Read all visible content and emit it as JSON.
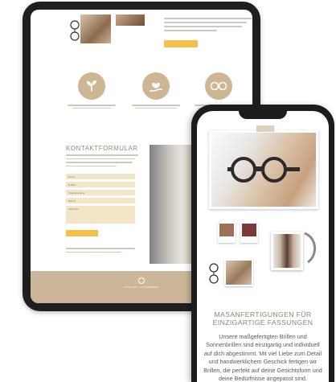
{
  "tablet": {
    "cta_label": "",
    "contact": {
      "title": "KONTAKTFORMULAR",
      "fields": [
        {
          "label": "Name"
        },
        {
          "label": "E-Mail"
        },
        {
          "label": "Telefonnummer"
        },
        {
          "label": "Betreff"
        },
        {
          "label": "Nachricht"
        }
      ],
      "submit_label": ""
    },
    "footer": {
      "brand": "OPTIKER LUTTERBERG",
      "tagline": ""
    },
    "feature_icons": [
      "seedling-icon",
      "hand-heart-icon",
      "glasses-icon"
    ]
  },
  "phone": {
    "heading": "MASANFERTIGUNGEN FÜR EINZIGARTIGE FASSUNGEN",
    "body": "Unsere maßgefertigten Brillen und Sonnenbrillen sind einzigartig und individuell auf dich abgestimmt. Mit viel Liebe zum Detail und handwerklichem Geschick fertigen wir Brillen, die perfekt auf deine Gesichtsform und deine Bedürfnisse angepasst sind.",
    "swatch_colors": [
      "#9a7256",
      "#7b3a3a"
    ]
  },
  "colors": {
    "accent": "#cbb699",
    "button": "#f3c14a"
  }
}
